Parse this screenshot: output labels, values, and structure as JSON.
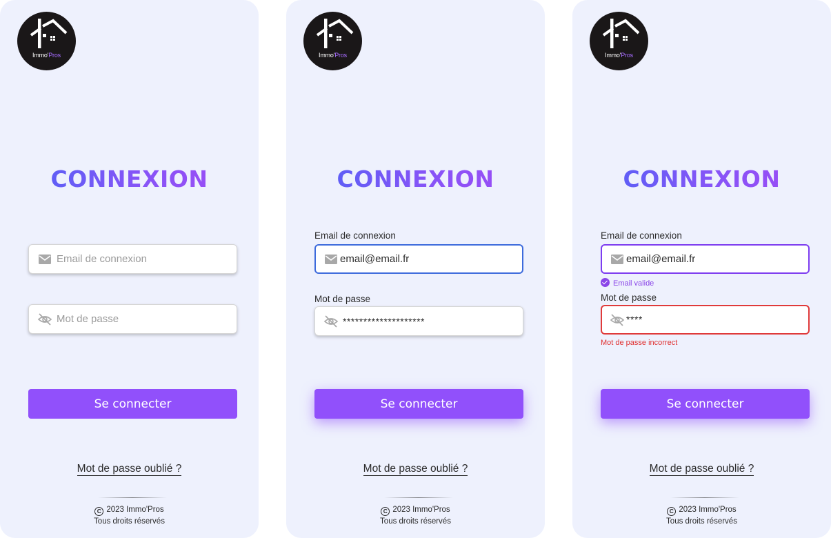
{
  "brand": {
    "name_part1": "Immo'",
    "name_part2": "Pros",
    "accent_color": "#9150fb",
    "title_gradient": [
      "#4a63f5",
      "#a24af5"
    ]
  },
  "screens": [
    {
      "state": "empty",
      "title": "CONNEXION",
      "email": {
        "label": "",
        "value": "",
        "placeholder": "Email de connexion",
        "icon": "mail-icon"
      },
      "password": {
        "label": "",
        "value": "",
        "placeholder": "Mot de passe",
        "icon": "eye-off-icon"
      },
      "submit_label": "Se connecter",
      "forgot_label": "Mot de passe oublié ?",
      "footer": {
        "copyright_symbol": "C",
        "copyright": "2023 Immo'Pros",
        "rights": "Tous droits réservés"
      }
    },
    {
      "state": "filled",
      "title": "CONNEXION",
      "email": {
        "label": "Email de connexion",
        "value": "email@email.fr",
        "placeholder": "",
        "icon": "mail-icon"
      },
      "password": {
        "label": "Mot de passe",
        "value": "********************",
        "placeholder": "",
        "icon": "eye-off-icon"
      },
      "submit_label": "Se connecter",
      "forgot_label": "Mot de passe oublié ?",
      "footer": {
        "copyright_symbol": "C",
        "copyright": "2023 Immo'Pros",
        "rights": "Tous droits réservés"
      }
    },
    {
      "state": "validation",
      "title": "CONNEXION",
      "email": {
        "label": "Email de connexion",
        "value": "email@email.fr",
        "placeholder": "",
        "icon": "mail-icon",
        "hint": "Email valide",
        "hint_color": "#8a45e8"
      },
      "password": {
        "label": "Mot de passe",
        "value": "****",
        "placeholder": "",
        "icon": "eye-off-icon",
        "hint": "Mot de passe incorrect",
        "hint_color": "#e03030"
      },
      "submit_label": "Se connecter",
      "forgot_label": "Mot de passe oublié ?",
      "footer": {
        "copyright_symbol": "C",
        "copyright": "2023 Immo'Pros",
        "rights": "Tous droits réservés"
      }
    }
  ]
}
